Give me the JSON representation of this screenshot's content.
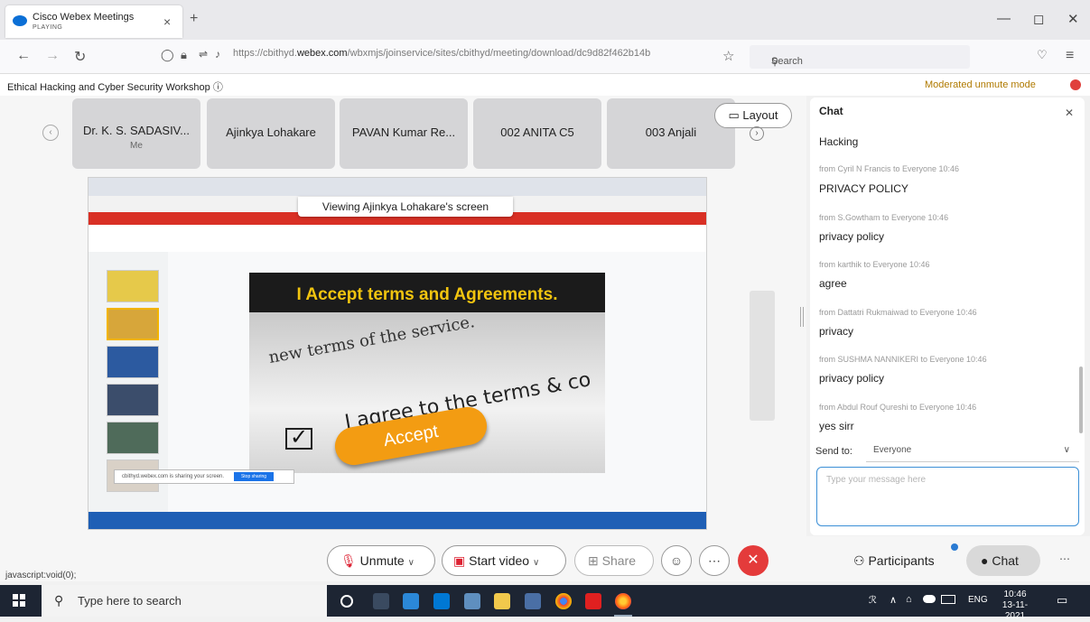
{
  "browser": {
    "tab_title": "Cisco Webex Meetings",
    "tab_status": "PLAYING",
    "url_prefix": "https://cbithyd.",
    "url_domain": "webex.com",
    "url_rest": "/wbxmjs/joinservice/sites/cbithyd/meeting/download/dc9d82f462b14b",
    "search_placeholder": "Search"
  },
  "meeting": {
    "title": "Ethical Hacking and Cyber Security Workshop",
    "moderated_mode": "Moderated unmute mode"
  },
  "participants": [
    {
      "name": "Dr. K. S. SADASIV...",
      "sub": "Me"
    },
    {
      "name": "Ajinkya Lohakare",
      "sub": ""
    },
    {
      "name": "PAVAN Kumar Re...",
      "sub": ""
    },
    {
      "name": "002 ANITA C5",
      "sub": ""
    },
    {
      "name": "003 Anjali",
      "sub": ""
    }
  ],
  "layout_label": "Layout",
  "share": {
    "viewing_label": "Viewing Ajinkya Lohakare's screen",
    "slide_title": "I Accept terms and Agreements.",
    "slide_line1": "new terms of the service.",
    "slide_line2": "I agree to the terms & co",
    "accept_label": "Accept",
    "sharing_note": "cbithyd.webex.com is sharing your screen.",
    "stop_sharing": "Stop sharing"
  },
  "chat": {
    "header": "Chat",
    "messages": [
      {
        "meta": "",
        "text": "Hacking"
      },
      {
        "meta": "from Cyril N Francis to Everyone   10:46",
        "text": "PRIVACY POLICY"
      },
      {
        "meta": "from S.Gowtham to Everyone   10:46",
        "text": "privacy policy"
      },
      {
        "meta": "from karthik to Everyone   10:46",
        "text": "agree"
      },
      {
        "meta": "from Dattatri Rukmaiwad to Everyone   10:46",
        "text": "privacy"
      },
      {
        "meta": "from SUSHMA NANNIKERI to Everyone   10:46",
        "text": "privacy policy"
      },
      {
        "meta": "from Abdul Rouf Qureshi to Everyone   10:46",
        "text": "yes sirr"
      }
    ],
    "send_to_label": "Send to:",
    "send_to_value": "Everyone",
    "input_placeholder": "Type your message here"
  },
  "controls": {
    "unmute": "Unmute",
    "start_video": "Start video",
    "share": "Share",
    "participants": "Participants",
    "chat": "Chat"
  },
  "status_bar": "javascript:void(0);",
  "taskbar": {
    "search_placeholder": "Type here to search",
    "lang": "ENG",
    "time": "10:46",
    "date": "13-11-2021"
  }
}
